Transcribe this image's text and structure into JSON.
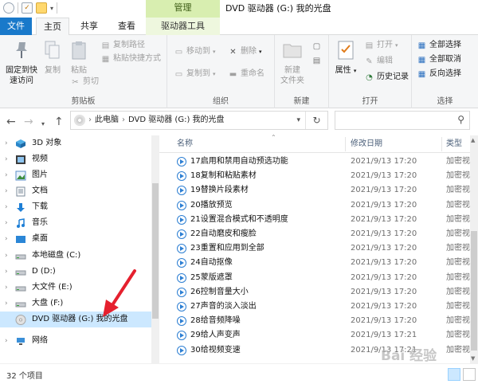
{
  "window": {
    "title": "DVD 驱动器 (G:) 我的光盘",
    "context_tab": "管理"
  },
  "tabs": {
    "file": "文件",
    "home": "主页",
    "share": "共享",
    "view": "查看",
    "drive_tools": "驱动器工具"
  },
  "ribbon": {
    "clipboard": {
      "label": "剪贴板",
      "pin": "固定到快\n速访问",
      "pin_line1": "固定到快",
      "pin_line2": "速访问",
      "copy": "复制",
      "paste": "粘贴",
      "copy_path": "复制路径",
      "paste_shortcut": "粘贴快捷方式",
      "cut": "剪切"
    },
    "organize": {
      "label": "组织",
      "move_to": "移动到",
      "copy_to": "复制到",
      "delete": "删除",
      "rename": "重命名"
    },
    "new": {
      "label": "新建",
      "new_folder_line1": "新建",
      "new_folder_line2": "文件夹"
    },
    "open": {
      "label": "打开",
      "properties": "属性",
      "open": "打开",
      "edit": "编辑",
      "history": "历史记录"
    },
    "select": {
      "label": "选择",
      "select_all": "全部选择",
      "select_none": "全部取消",
      "invert": "反向选择"
    }
  },
  "address": {
    "crumbs": [
      "此电脑",
      "DVD 驱动器 (G:) 我的光盘"
    ],
    "search_placeholder": ""
  },
  "nav": {
    "items": [
      {
        "label": "3D 对象",
        "icon": "3d-objects-icon"
      },
      {
        "label": "视频",
        "icon": "videos-icon"
      },
      {
        "label": "图片",
        "icon": "pictures-icon"
      },
      {
        "label": "文档",
        "icon": "documents-icon"
      },
      {
        "label": "下载",
        "icon": "downloads-icon"
      },
      {
        "label": "音乐",
        "icon": "music-icon"
      },
      {
        "label": "桌面",
        "icon": "desktop-icon"
      },
      {
        "label": "本地磁盘 (C:)",
        "icon": "drive-icon"
      },
      {
        "label": "D (D:)",
        "icon": "drive-icon"
      },
      {
        "label": "大文件 (E:)",
        "icon": "drive-icon"
      },
      {
        "label": "大盘 (F:)",
        "icon": "drive-icon"
      },
      {
        "label": "DVD 驱动器 (G:) 我的光盘",
        "icon": "dvd-icon"
      },
      {
        "label": "网络",
        "icon": "network-icon"
      }
    ]
  },
  "columns": {
    "name": "名称",
    "date": "修改日期",
    "type": "类型"
  },
  "files": [
    {
      "name": "17启用和禁用自动预选功能",
      "date": "2021/9/13 17:20",
      "type": "加密视"
    },
    {
      "name": "18复制和粘贴素材",
      "date": "2021/9/13 17:20",
      "type": "加密视"
    },
    {
      "name": "19替换片段素材",
      "date": "2021/9/13 17:20",
      "type": "加密视"
    },
    {
      "name": "20播放预览",
      "date": "2021/9/13 17:20",
      "type": "加密视"
    },
    {
      "name": "21设置混合模式和不透明度",
      "date": "2021/9/13 17:20",
      "type": "加密视"
    },
    {
      "name": "22自动磨皮和瘦脸",
      "date": "2021/9/13 17:20",
      "type": "加密视"
    },
    {
      "name": "23重置和应用到全部",
      "date": "2021/9/13 17:20",
      "type": "加密视"
    },
    {
      "name": "24自动抠像",
      "date": "2021/9/13 17:20",
      "type": "加密视"
    },
    {
      "name": "25蒙版遮罩",
      "date": "2021/9/13 17:20",
      "type": "加密视"
    },
    {
      "name": "26控制音量大小",
      "date": "2021/9/13 17:20",
      "type": "加密视"
    },
    {
      "name": "27声音的淡入淡出",
      "date": "2021/9/13 17:20",
      "type": "加密视"
    },
    {
      "name": "28给音频降噪",
      "date": "2021/9/13 17:20",
      "type": "加密视"
    },
    {
      "name": "29给人声变声",
      "date": "2021/9/13 17:21",
      "type": "加密视"
    },
    {
      "name": "30给视频变速",
      "date": "2021/9/13 17:21",
      "type": "加密视"
    }
  ],
  "status": {
    "count": "32 个项目"
  },
  "watermark": "Bai 经验"
}
